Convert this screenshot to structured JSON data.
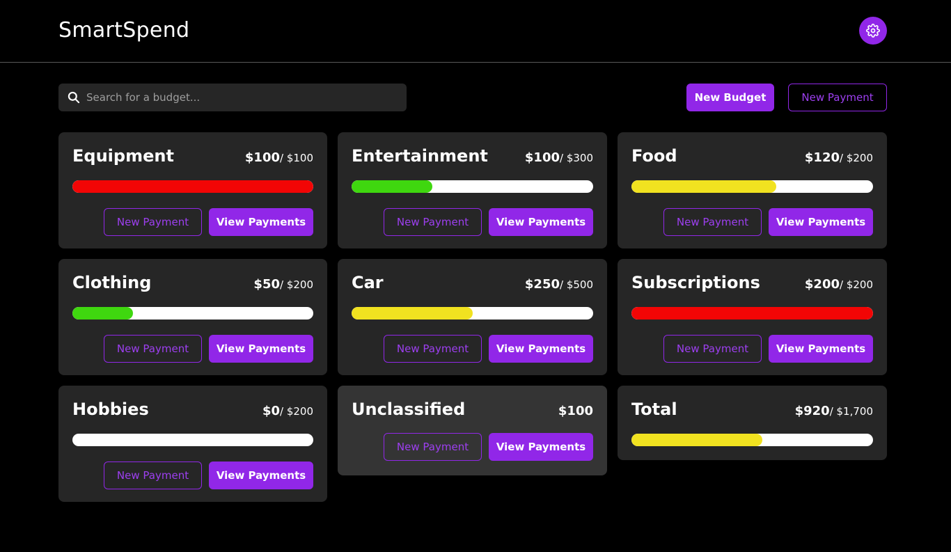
{
  "app": {
    "title": "SmartSpend"
  },
  "search": {
    "placeholder": "Search for a budget..."
  },
  "toolbar": {
    "new_budget": "New Budget",
    "new_payment": "New Payment"
  },
  "colors": {
    "accent": "#9127e8",
    "red": "#f20505",
    "green": "#3fd70f",
    "yellow": "#f1e220"
  },
  "icons": {
    "settings": "gear-icon",
    "search": "search-icon"
  },
  "budgets": [
    {
      "name": "Equipment",
      "spent": "$100",
      "max": "/ $100",
      "progress": 1.0,
      "color": "#f20505",
      "new_payment": "New Payment",
      "view_payments": "View Payments"
    },
    {
      "name": "Entertainment",
      "spent": "$100",
      "max": "/ $300",
      "progress": 0.333,
      "color": "#3fd70f",
      "new_payment": "New Payment",
      "view_payments": "View Payments"
    },
    {
      "name": "Food",
      "spent": "$120",
      "max": "/ $200",
      "progress": 0.6,
      "color": "#f1e220",
      "new_payment": "New Payment",
      "view_payments": "View Payments"
    },
    {
      "name": "Clothing",
      "spent": "$50",
      "max": "/ $200",
      "progress": 0.25,
      "color": "#3fd70f",
      "new_payment": "New Payment",
      "view_payments": "View Payments"
    },
    {
      "name": "Car",
      "spent": "$250",
      "max": "/ $500",
      "progress": 0.5,
      "color": "#f1e220",
      "new_payment": "New Payment",
      "view_payments": "View Payments"
    },
    {
      "name": "Subscriptions",
      "spent": "$200",
      "max": "/ $200",
      "progress": 1.0,
      "color": "#f20505",
      "new_payment": "New Payment",
      "view_payments": "View Payments"
    },
    {
      "name": "Hobbies",
      "spent": "$0",
      "max": "/ $200",
      "progress": 0.0,
      "color": "#f1e220",
      "new_payment": "New Payment",
      "view_payments": "View Payments"
    }
  ],
  "unclassified": {
    "name": "Unclassified",
    "spent": "$100",
    "new_payment": "New Payment",
    "view_payments": "View Payments"
  },
  "total": {
    "name": "Total",
    "spent": "$920",
    "max": "/ $1,700",
    "progress": 0.541,
    "color": "#f1e220"
  }
}
